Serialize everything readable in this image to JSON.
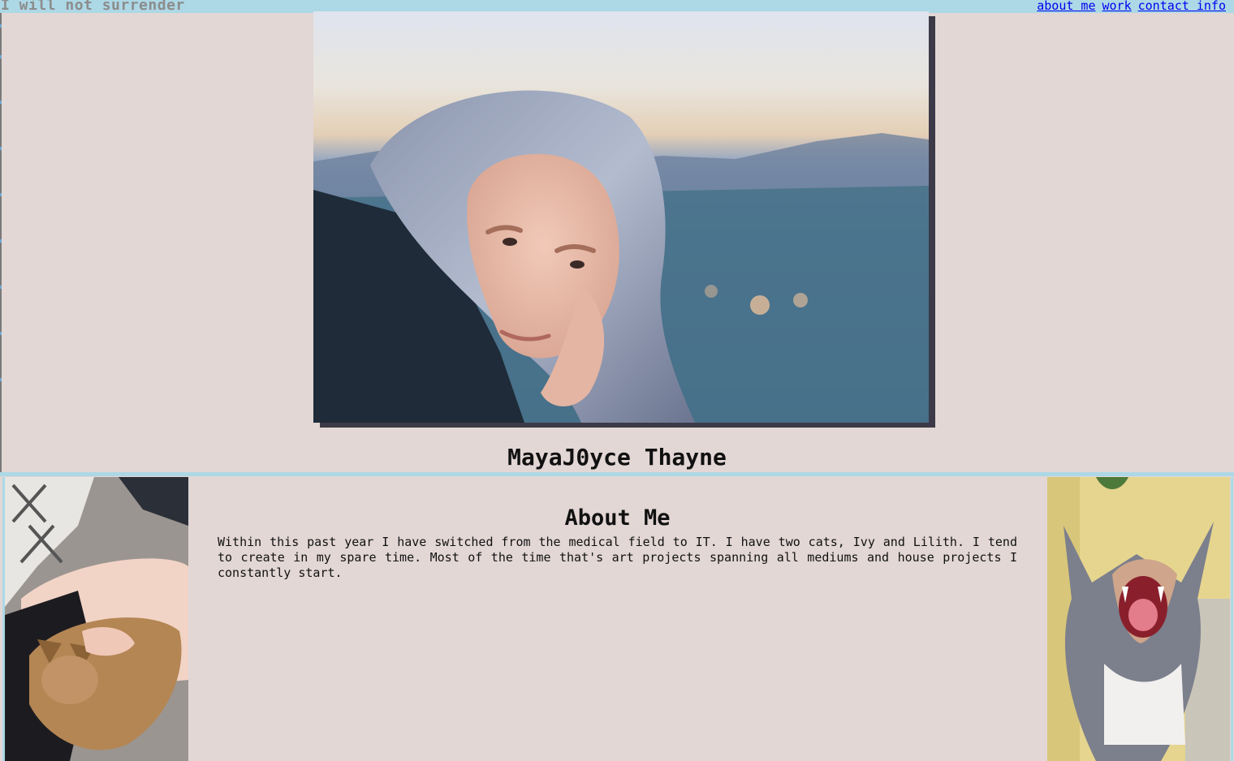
{
  "header": {
    "tagline": "I will not surrender",
    "nav": [
      "about me",
      "work",
      "contact info"
    ]
  },
  "profile": {
    "name": "MayaJ0yce Thayne"
  },
  "about": {
    "title": "About Me",
    "text": "Within this past year I have switched from the medical field to IT. I have two cats, Ivy and Lilith. I tend to create in my spare time. Most of the time that's art projects spanning all mediums and house projects I constantly start."
  },
  "colors": {
    "topbar": "#add8e6",
    "background": "#e2d7d5",
    "link": "#0000ee",
    "tagline": "#8c8c8c",
    "photo_shadow": "#3c3a48"
  }
}
